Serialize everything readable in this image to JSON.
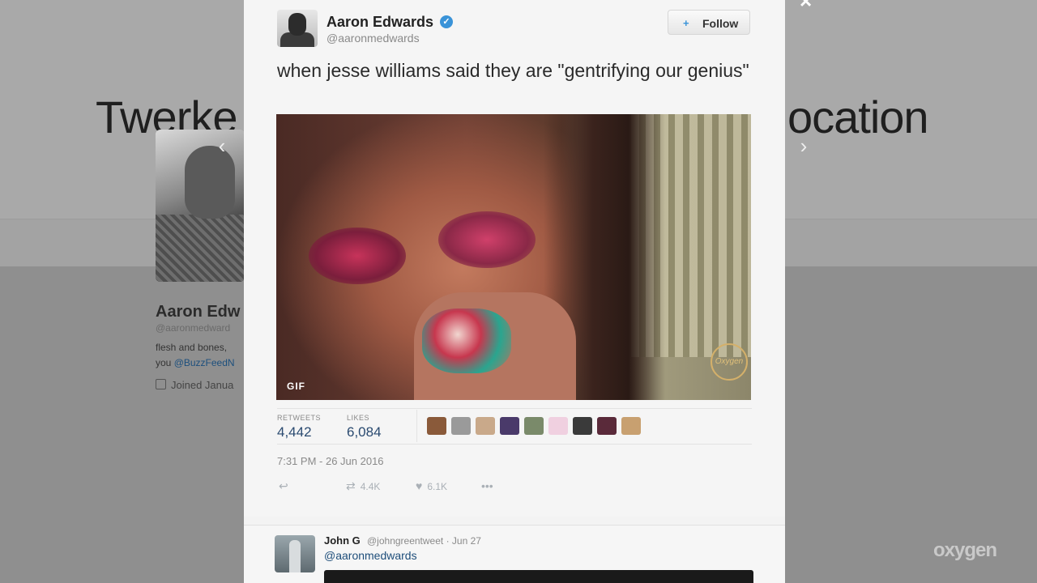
{
  "background": {
    "headline_left": "Twerke",
    "headline_right": "ocation",
    "profile": {
      "name": "Aaron Edw",
      "handle": "@aaronmedward",
      "bio_line1": "flesh and bones,",
      "bio_line2_prefix": "you ",
      "bio_mention": "@BuzzFeedN",
      "joined": "Joined Janua"
    },
    "nav_prev_icon": "chevron-left-icon",
    "nav_next_icon": "chevron-right-icon",
    "prev_glyph": "‹",
    "next_glyph": "›",
    "close_glyph": "×"
  },
  "tweet": {
    "author_name": "Aaron Edwards",
    "author_handle": "@aaronmedwards",
    "verified_glyph": "✓",
    "follow_icon": "+",
    "follow_label": "Follow",
    "text": "when jesse williams said they are \"gentrifying our genius\"",
    "media_badge": "GIF",
    "media_logo": "Oxygen",
    "retweets_label": "RETWEETS",
    "retweets_value": "4,442",
    "likes_label": "LIKES",
    "likes_value": "6,084",
    "timestamp": "7:31 PM - 26 Jun 2016",
    "actions": {
      "reply_glyph": "↩",
      "retweet_glyph": "⇄",
      "retweet_count": "4.4K",
      "like_glyph": "♥",
      "like_count": "6.1K",
      "more_glyph": "•••"
    },
    "liker_colors": [
      "#8a5a3a",
      "#9a9a9a",
      "#c9a98a",
      "#4a3a6a",
      "#7a8a6a",
      "#f0d0e0",
      "#3a3a3a",
      "#5a2a3a",
      "#c8a070"
    ]
  },
  "reply": {
    "name": "John G",
    "meta": "@johngreentweet · Jun 27",
    "text": "@aaronmedwards"
  },
  "watermark": "oxygen",
  "colors": {
    "accent": "#3a93d8",
    "link": "#1e4e7a",
    "stat_value": "#2a4a70"
  }
}
